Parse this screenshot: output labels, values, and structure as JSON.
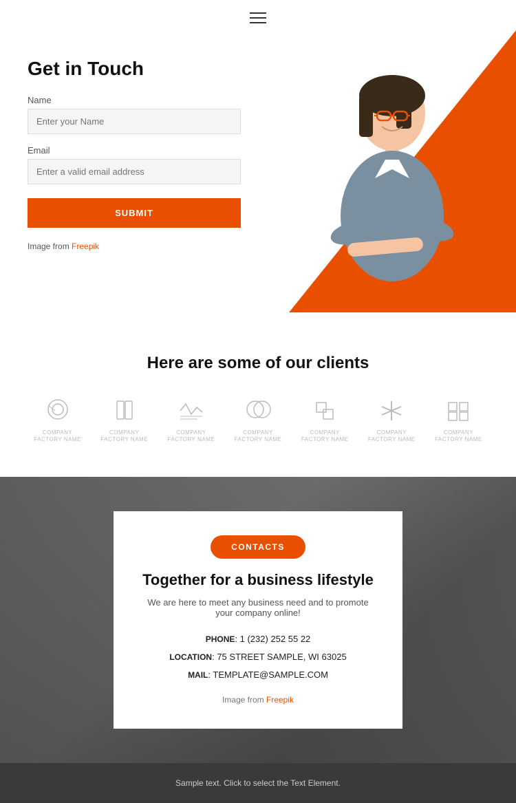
{
  "header": {
    "menu_icon_label": "menu"
  },
  "contact_section": {
    "title": "Get in Touch",
    "name_label": "Name",
    "name_placeholder": "Enter your Name",
    "email_label": "Email",
    "email_placeholder": "Enter a valid email address",
    "submit_label": "SUBMIT",
    "image_credit_text": "Image from ",
    "image_credit_link": "Freepik",
    "image_credit_url": "#"
  },
  "clients_section": {
    "title": "Here are some of our clients",
    "logos": [
      {
        "label": "COMPANY\nFACTORY NAME",
        "type": "circle-o"
      },
      {
        "label": "COMPANY\nFACTORY NAME",
        "type": "book"
      },
      {
        "label": "COMPANY\nFACTORY NAME",
        "type": "check-lines"
      },
      {
        "label": "COMPANY\nFACTORY NAME",
        "type": "rings"
      },
      {
        "label": "COMPANY\nFACTORY NAME",
        "type": "squares"
      },
      {
        "label": "COMPANY\nFACTORY NAME",
        "type": "lines-cross"
      },
      {
        "label": "COMPANY\nFACTORY NAME",
        "type": "puzzle"
      }
    ]
  },
  "contacts_section": {
    "contacts_btn_label": "CONTACTS",
    "heading": "Together for a business lifestyle",
    "subtitle": "We are here to meet any business need and to promote your company online!",
    "phone_label": "PHONE",
    "phone_value": "1 (232) 252 55 22",
    "location_label": "LOCATION",
    "location_value": "75 STREET SAMPLE, WI 63025",
    "mail_label": "MAIL",
    "mail_value": "TEMPLATE@SAMPLE.COM",
    "image_credit_text": "Image from ",
    "image_credit_link": "Freepik",
    "image_credit_url": "#"
  },
  "footer": {
    "sample_text": "Sample text. Click to select the Text Element."
  }
}
